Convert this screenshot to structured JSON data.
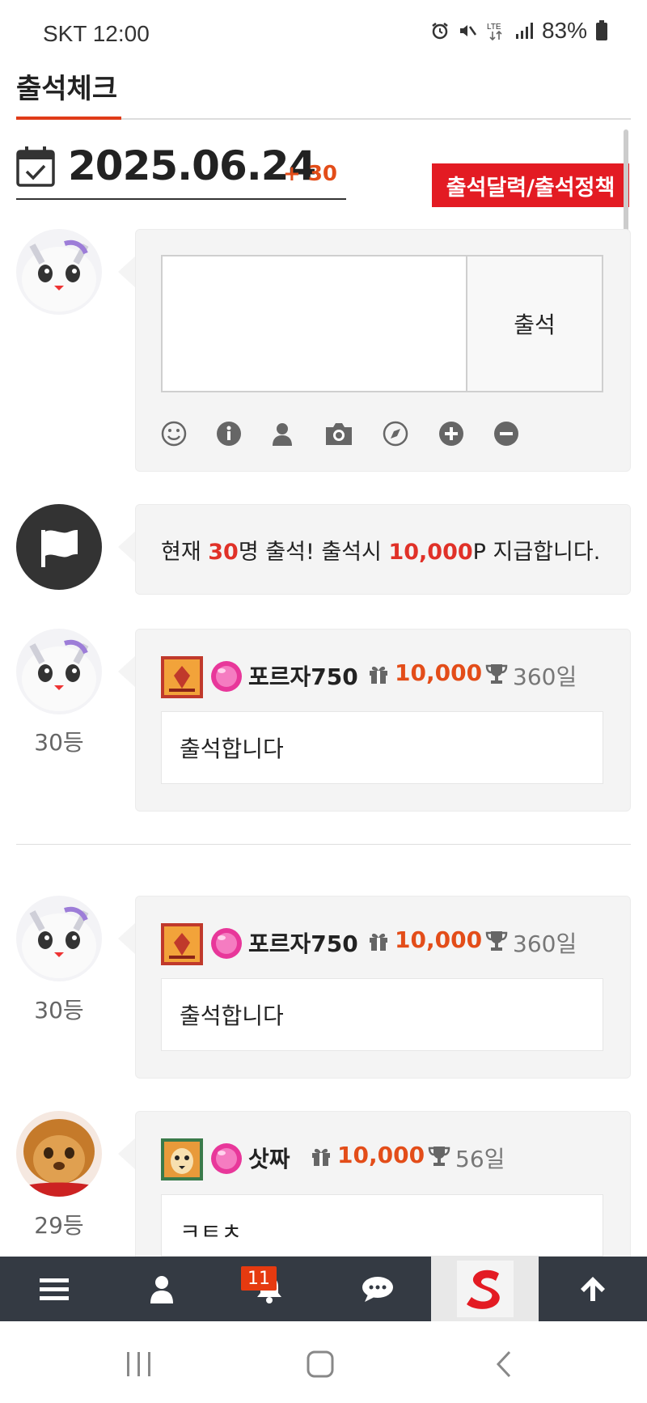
{
  "status_bar": {
    "carrier_time": "SKT 12:00",
    "battery": "83%"
  },
  "page": {
    "title": "출석체크"
  },
  "attendance": {
    "date": "2025.06.24",
    "plus": "+ 30",
    "policy_button": "출석달력/출석정책",
    "submit_button": "출석",
    "textarea_value": ""
  },
  "notice": {
    "prefix": "현재 ",
    "count": "30",
    "middle": "명 출석! 출석시 ",
    "points": "10,000",
    "suffix": "P 지급합니다."
  },
  "entries": [
    {
      "rank": "30등",
      "name": "포르자750",
      "points": "10,000",
      "days": "360일",
      "comment": "출석합니다"
    },
    {
      "rank": "30등",
      "name": "포르자750",
      "points": "10,000",
      "days": "360일",
      "comment": "출석합니다"
    },
    {
      "rank": "29등",
      "name": "삿짜",
      "points": "10,000",
      "days": "56일",
      "comment": "ㅋㅌㅊ"
    }
  ],
  "bottom_nav": {
    "notification_count": "11"
  },
  "colors": {
    "accent_red": "#e31b23",
    "points_orange": "#e34d19",
    "nav_bg": "#343a43"
  }
}
